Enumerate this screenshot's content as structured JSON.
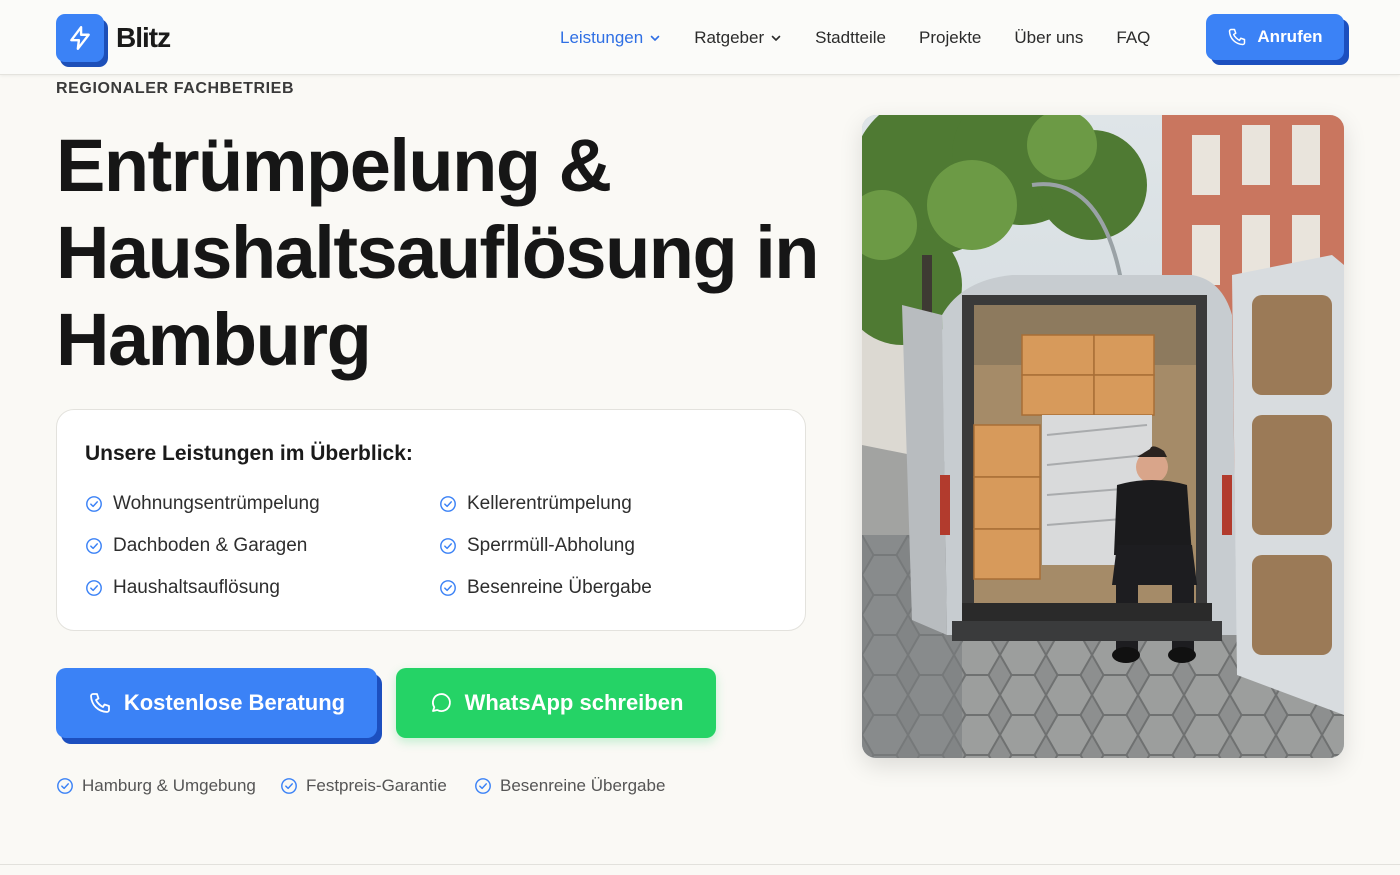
{
  "brand": {
    "name": "Blitz",
    "accent": "#3b82f6",
    "accent_dark": "#1c4fbf",
    "whatsapp_color": "#25d366"
  },
  "nav": {
    "items": [
      {
        "label": "Leistungen",
        "has_dropdown": true,
        "active": true
      },
      {
        "label": "Ratgeber",
        "has_dropdown": true,
        "active": false
      },
      {
        "label": "Stadtteile",
        "has_dropdown": false,
        "active": false
      },
      {
        "label": "Projekte",
        "has_dropdown": false,
        "active": false
      },
      {
        "label": "Über uns",
        "has_dropdown": false,
        "active": false
      },
      {
        "label": "FAQ",
        "has_dropdown": false,
        "active": false
      }
    ],
    "call_label": "Anrufen",
    "call_icon": "phone-icon"
  },
  "hero": {
    "eyebrow": "REGIONALER FACHBETRIEB",
    "headline_line1": "Entrümpelung &",
    "headline_line2": "Haushaltsauflösung in",
    "headline_line3": "Hamburg",
    "services": {
      "title": "Unsere Leistungen im Überblick:",
      "items": [
        "Wohnungsentrümpelung",
        "Kellerentrümpelung",
        "Dachboden & Garagen",
        "Sperrmüll-Abholung",
        "Haushaltsauflösung",
        "Besenreine Übergabe"
      ]
    },
    "cta_primary": "Kostenlose Beratung",
    "cta_whatsapp": "WhatsApp schreiben",
    "trust_badges": [
      "Hamburg & Umgebung",
      "Festpreis-Garantie",
      "Besenreine Übergabe"
    ]
  }
}
